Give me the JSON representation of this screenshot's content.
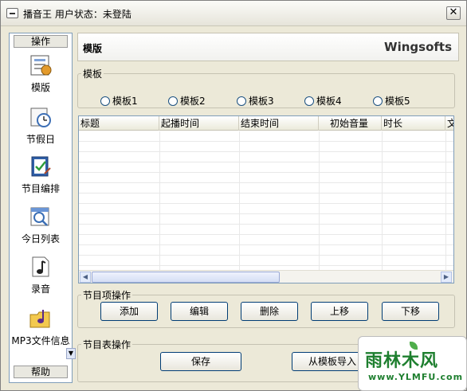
{
  "window": {
    "title": "播音王  用户状态：未登陆",
    "close_glyph": "✕"
  },
  "nav": {
    "header": "操作",
    "footer": "帮助",
    "items": [
      {
        "label": "模版",
        "icon": "template-icon"
      },
      {
        "label": "节假日",
        "icon": "holiday-clock-icon"
      },
      {
        "label": "节目编排",
        "icon": "schedule-edit-icon"
      },
      {
        "label": "今日列表",
        "icon": "today-list-icon"
      },
      {
        "label": "录音",
        "icon": "music-note-icon"
      },
      {
        "label": "MP3文件信息",
        "icon": "folder-music-icon"
      }
    ]
  },
  "header": {
    "title": "模版",
    "brand": "Wingsofts"
  },
  "template_group": {
    "legend": "模板",
    "options": [
      "模板1",
      "模板2",
      "模板3",
      "模板4",
      "模板5"
    ]
  },
  "table": {
    "columns": [
      "标题",
      "起播时间",
      "结束时间",
      "初始音量",
      "时长",
      "文"
    ]
  },
  "item_ops": {
    "legend": "节目项操作",
    "buttons": [
      "添加",
      "编辑",
      "删除",
      "上移",
      "下移"
    ]
  },
  "schedule_ops": {
    "legend": "节目表操作",
    "buttons": [
      "保存",
      "从模板导入"
    ]
  },
  "watermark": {
    "main": "雨林木风",
    "sub": "www.YLMFU.com"
  },
  "colors": {
    "accent_border": "#7f9db9",
    "button_border": "#003c74",
    "window_bg": "#ece9d8"
  }
}
